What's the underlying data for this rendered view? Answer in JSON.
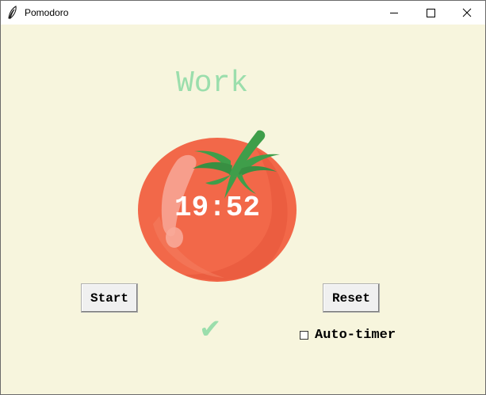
{
  "window": {
    "title": "Pomodoro",
    "controls": [
      "minimize",
      "maximize",
      "close"
    ]
  },
  "timer": {
    "mode_label": "Work",
    "time": "19:52",
    "check_marks": "✔"
  },
  "buttons": {
    "start_label": "Start",
    "reset_label": "Reset"
  },
  "auto_timer": {
    "label": "Auto-timer",
    "checked": false
  },
  "colors": {
    "background": "#f7f5dd",
    "mode_label": "#9bdeac",
    "check_marks": "#9bdeac",
    "timer_text": "#ffffff",
    "tomato": "#f26849",
    "leaf": "#3f9e4a"
  },
  "icons": {
    "app": "feather-icon",
    "minimize": "minimize-icon",
    "maximize": "maximize-icon",
    "close": "close-icon",
    "tomato": "tomato-icon"
  }
}
